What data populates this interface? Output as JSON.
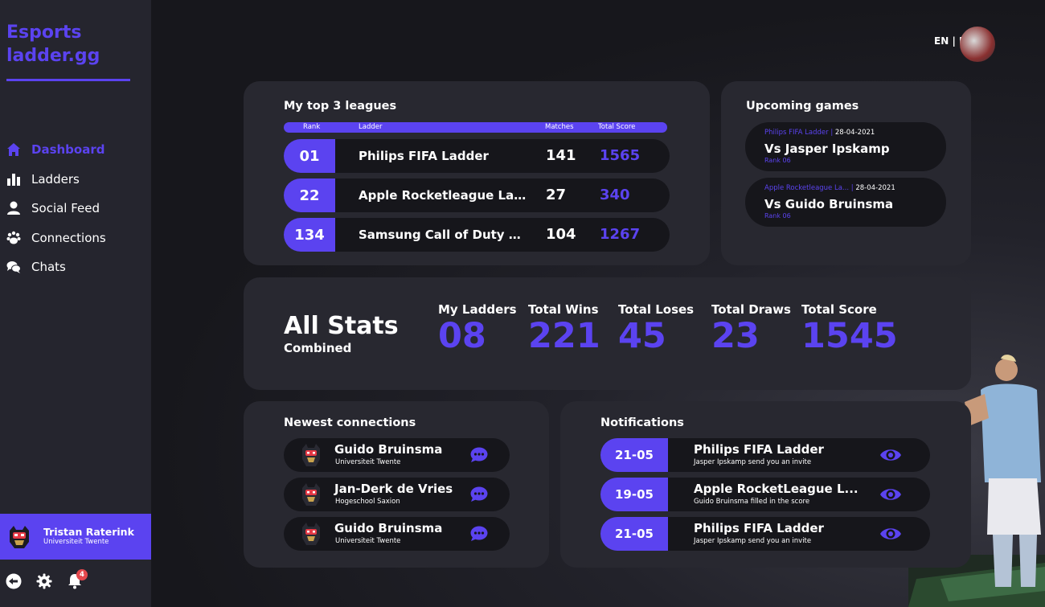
{
  "app": {
    "logo": "Esports ladder.gg"
  },
  "nav": {
    "items": [
      {
        "label": "Dashboard",
        "icon": "home-icon",
        "active": true
      },
      {
        "label": "Ladders",
        "icon": "bar-chart-icon"
      },
      {
        "label": "Social Feed",
        "icon": "user-icon"
      },
      {
        "label": "Connections",
        "icon": "paw-icon"
      },
      {
        "label": "Chats",
        "icon": "chat-bubbles-icon"
      }
    ]
  },
  "user": {
    "name": "Tristan Raterink",
    "org": "Universiteit Twente"
  },
  "notifications_count": "4",
  "lang": {
    "en": "EN",
    "separator": "|",
    "nl": "NL"
  },
  "leagues": {
    "title": "My top 3 leagues",
    "headers": {
      "rank": "Rank",
      "ladder": "Ladder",
      "matches": "Matches",
      "score": "Total Score"
    },
    "rows": [
      {
        "rank": "01",
        "name": "Philips FIFA Ladder",
        "matches": "141",
        "score": "1565"
      },
      {
        "rank": "22",
        "name": "Apple Rocketleague La...",
        "matches": "27",
        "score": "340"
      },
      {
        "rank": "134",
        "name": "Samsung Call of Duty L...",
        "matches": "104",
        "score": "1267"
      }
    ]
  },
  "upcoming": {
    "title": "Upcoming games",
    "games": [
      {
        "league": "Philips FIFA Ladder",
        "date": "28-04-2021",
        "vs": "Vs Jasper Ipskamp",
        "rank": "Rank 06"
      },
      {
        "league": "Apple Rocketleague La...",
        "date": "28-04-2021",
        "vs": "Vs Guido Bruinsma",
        "rank": "Rank 06"
      }
    ]
  },
  "stats": {
    "title": "All Stats",
    "subtitle": "Combined",
    "items": [
      {
        "label": "My Ladders",
        "value": "08"
      },
      {
        "label": "Total Wins",
        "value": "221"
      },
      {
        "label": "Total Loses",
        "value": "45"
      },
      {
        "label": "Total Draws",
        "value": "23"
      },
      {
        "label": "Total Score",
        "value": "1545"
      }
    ]
  },
  "connections": {
    "title": "Newest connections",
    "items": [
      {
        "name": "Guido Bruinsma",
        "org": "Universiteit Twente"
      },
      {
        "name": "Jan-Derk de Vries",
        "org": "Hogeschool Saxion"
      },
      {
        "name": "Guido Bruinsma",
        "org": "Universiteit Twente"
      }
    ]
  },
  "notifications": {
    "title": "Notifications",
    "items": [
      {
        "date": "21-05",
        "title": "Philips FIFA Ladder",
        "desc": "Jasper Ipskamp send you an invite"
      },
      {
        "date": "19-05",
        "title": "Apple RocketLeague L...",
        "desc": "Guido Bruinsma filled in the score"
      },
      {
        "date": "21-05",
        "title": "Philips FIFA Ladder",
        "desc": "Jasper Ipskamp send you an invite"
      }
    ]
  },
  "colors": {
    "accent": "#5b43f0",
    "sidebar": "#25252e",
    "card": "#282830",
    "row": "#16161b"
  }
}
